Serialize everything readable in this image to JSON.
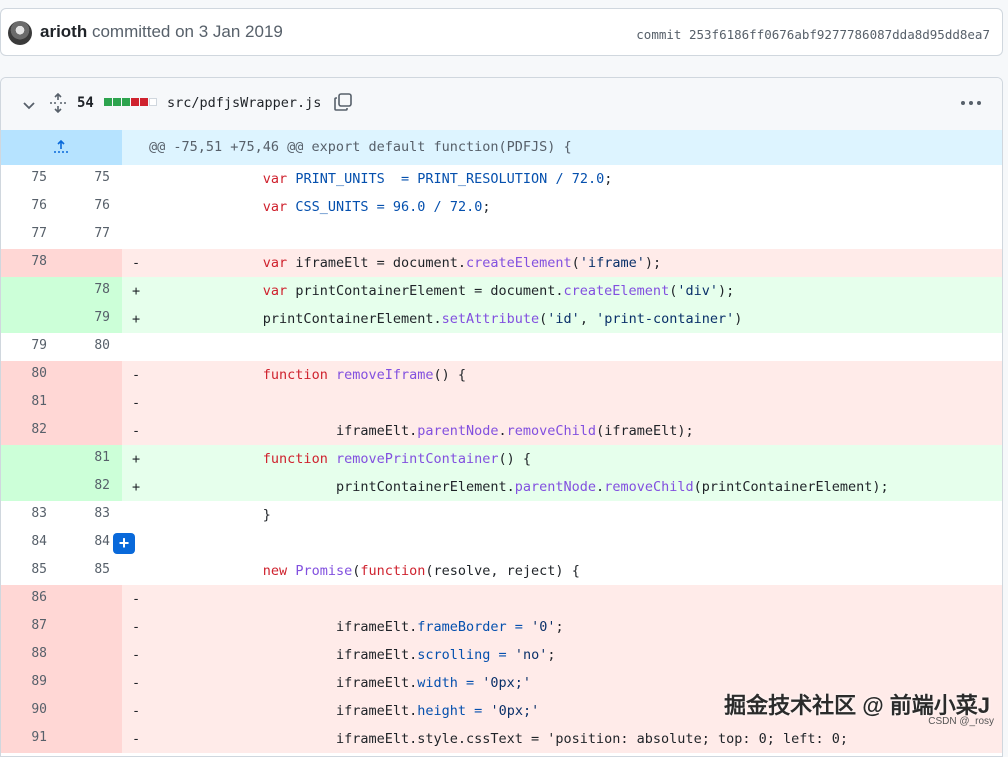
{
  "commit": {
    "author": "arioth",
    "action": " committed on 3 Jan 2019",
    "hash": "commit 253f6186ff0676abf9277786087dda8d95dd8ea7"
  },
  "file": {
    "changes": "54",
    "diffstat": [
      "add",
      "add",
      "add",
      "del",
      "del",
      "neu"
    ],
    "path": "src/pdfjsWrapper.js",
    "hunk": "@@ -75,51 +75,46 @@ export default function(PDFJS) {"
  },
  "lines": [
    {
      "type": "ctx",
      "old": "75",
      "new": "75",
      "marker": "",
      "code": [
        [
          "k",
          "var "
        ],
        [
          "c",
          "PRINT_UNITS"
        ],
        [
          "",
          "  "
        ],
        [
          "c",
          "="
        ],
        [
          "",
          " "
        ],
        [
          "c",
          "PRINT_RESOLUTION"
        ],
        [
          "",
          " "
        ],
        [
          "c",
          "/"
        ],
        [
          "",
          " "
        ],
        [
          "c",
          "72.0"
        ],
        [
          "",
          ";"
        ]
      ]
    },
    {
      "type": "ctx",
      "old": "76",
      "new": "76",
      "marker": "",
      "code": [
        [
          "k",
          "var "
        ],
        [
          "c",
          "CSS_UNITS"
        ],
        [
          "",
          " "
        ],
        [
          "c",
          "="
        ],
        [
          "",
          " "
        ],
        [
          "c",
          "96.0"
        ],
        [
          "",
          " "
        ],
        [
          "c",
          "/"
        ],
        [
          "",
          " "
        ],
        [
          "c",
          "72.0"
        ],
        [
          "",
          ";"
        ]
      ]
    },
    {
      "type": "ctx",
      "old": "77",
      "new": "77",
      "marker": "",
      "code": []
    },
    {
      "type": "del",
      "old": "78",
      "new": "",
      "marker": "-",
      "code": [
        [
          "k",
          "var "
        ],
        [
          "",
          "iframeElt "
        ],
        [
          "",
          "= document."
        ],
        [
          "f",
          "createElement"
        ],
        [
          "",
          "("
        ],
        [
          "s",
          "'iframe'"
        ],
        [
          "",
          ");"
        ]
      ]
    },
    {
      "type": "add",
      "old": "",
      "new": "78",
      "marker": "+",
      "code": [
        [
          "k",
          "var "
        ],
        [
          "",
          "printContainerElement = document."
        ],
        [
          "f",
          "createElement"
        ],
        [
          "",
          "("
        ],
        [
          "s",
          "'div'"
        ],
        [
          "",
          ");"
        ]
      ]
    },
    {
      "type": "add",
      "old": "",
      "new": "79",
      "marker": "+",
      "code": [
        [
          "",
          "printContainerElement."
        ],
        [
          "f",
          "setAttribute"
        ],
        [
          "",
          "("
        ],
        [
          "s",
          "'id'"
        ],
        [
          "",
          ", "
        ],
        [
          "s",
          "'print-container'"
        ],
        [
          "",
          ")"
        ]
      ]
    },
    {
      "type": "ctx",
      "old": "79",
      "new": "80",
      "marker": "",
      "code": []
    },
    {
      "type": "del",
      "old": "80",
      "new": "",
      "marker": "-",
      "code": [
        [
          "k",
          "function "
        ],
        [
          "f",
          "removeIframe"
        ],
        [
          "",
          "() {"
        ]
      ]
    },
    {
      "type": "del",
      "old": "81",
      "new": "",
      "marker": "-",
      "code": []
    },
    {
      "type": "del",
      "old": "82",
      "new": "",
      "marker": "-",
      "code": [
        [
          "",
          "         iframeElt."
        ],
        [
          "f",
          "parentNode"
        ],
        [
          "",
          "."
        ],
        [
          "f",
          "removeChild"
        ],
        [
          "",
          "(iframeElt);"
        ]
      ]
    },
    {
      "type": "add",
      "old": "",
      "new": "81",
      "marker": "+",
      "code": [
        [
          "k",
          "function "
        ],
        [
          "f",
          "removePrintContainer"
        ],
        [
          "",
          "() {"
        ]
      ]
    },
    {
      "type": "add",
      "old": "",
      "new": "82",
      "marker": "+",
      "code": [
        [
          "",
          "         printContainerElement."
        ],
        [
          "f",
          "parentNode"
        ],
        [
          "",
          "."
        ],
        [
          "f",
          "removeChild"
        ],
        [
          "",
          "(printContainerElement);"
        ]
      ]
    },
    {
      "type": "ctx",
      "old": "83",
      "new": "83",
      "marker": "",
      "code": [
        [
          "",
          "}"
        ]
      ]
    },
    {
      "type": "ctx",
      "old": "84",
      "new": "84",
      "marker": "",
      "code": [],
      "plus": true
    },
    {
      "type": "ctx",
      "old": "85",
      "new": "85",
      "marker": "",
      "code": [
        [
          "k",
          "new "
        ],
        [
          "f",
          "Promise"
        ],
        [
          "",
          "("
        ],
        [
          "k",
          "function"
        ],
        [
          "",
          "(resolve, reject) {"
        ]
      ]
    },
    {
      "type": "del",
      "old": "86",
      "new": "",
      "marker": "-",
      "code": []
    },
    {
      "type": "del",
      "old": "87",
      "new": "",
      "marker": "-",
      "code": [
        [
          "",
          "         iframeElt."
        ],
        [
          "c",
          "frameBorder"
        ],
        [
          "",
          " "
        ],
        [
          "c",
          "="
        ],
        [
          "",
          " "
        ],
        [
          "s",
          "'0'"
        ],
        [
          "",
          ";"
        ]
      ]
    },
    {
      "type": "del",
      "old": "88",
      "new": "",
      "marker": "-",
      "code": [
        [
          "",
          "         iframeElt."
        ],
        [
          "c",
          "scrolling"
        ],
        [
          "",
          " "
        ],
        [
          "c",
          "="
        ],
        [
          "",
          " "
        ],
        [
          "s",
          "'no'"
        ],
        [
          "",
          ";"
        ]
      ]
    },
    {
      "type": "del",
      "old": "89",
      "new": "",
      "marker": "-",
      "code": [
        [
          "",
          "         iframeElt."
        ],
        [
          "c",
          "width"
        ],
        [
          "",
          " "
        ],
        [
          "c",
          "="
        ],
        [
          "",
          " "
        ],
        [
          "s",
          "'0px;'"
        ]
      ]
    },
    {
      "type": "del",
      "old": "90",
      "new": "",
      "marker": "-",
      "code": [
        [
          "",
          "         iframeElt."
        ],
        [
          "c",
          "height"
        ],
        [
          "",
          " "
        ],
        [
          "c",
          "="
        ],
        [
          "",
          " "
        ],
        [
          "s",
          "'0px;'"
        ]
      ]
    },
    {
      "type": "del",
      "old": "91",
      "new": "",
      "marker": "-",
      "code": [
        [
          "",
          "         iframeElt.style.cssText = 'position: absolute; top: 0; left: 0; "
        ]
      ]
    }
  ],
  "watermark": {
    "main": "掘金技术社区 @ 前端小菜J",
    "sub": "CSDN @_rosy"
  }
}
